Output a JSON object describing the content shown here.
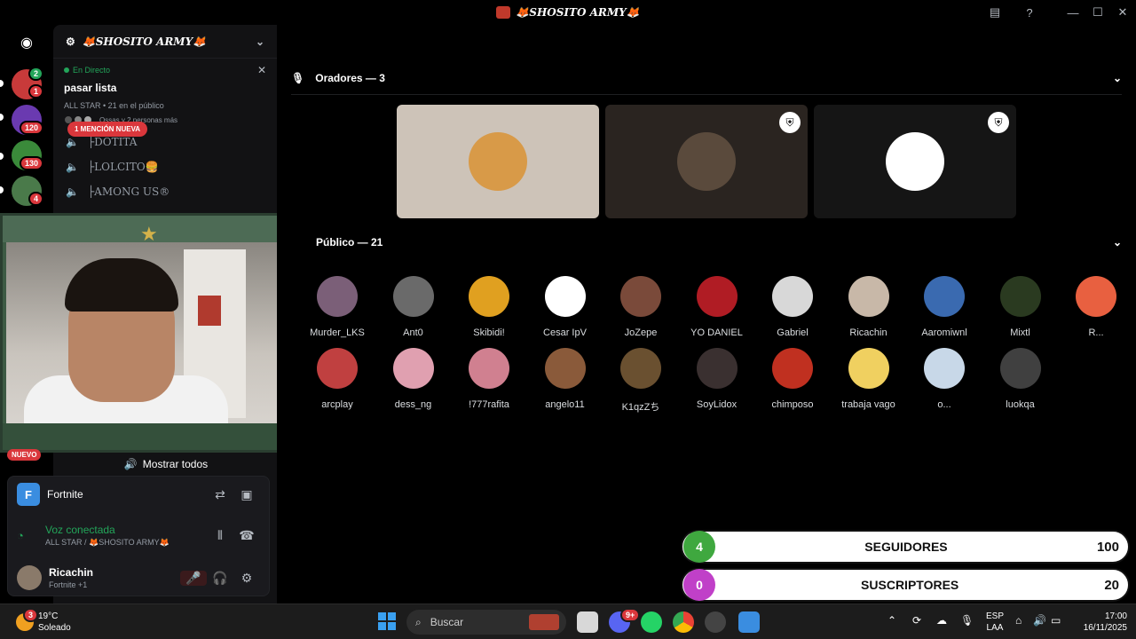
{
  "window": {
    "title": "🦊SHOSITO ARMY🦊",
    "controls": [
      "inbox-icon",
      "help-icon",
      "minimize",
      "maximize",
      "close"
    ]
  },
  "rail": {
    "badges": [
      "1",
      "120",
      "130",
      "4"
    ],
    "sub_badge": "2"
  },
  "server": {
    "name": "🦊SHOSITO ARMY🦊"
  },
  "live": {
    "tag": "En Directo",
    "title": "pasar lista",
    "meta": "ALL STAR • 21 en el público",
    "more": "Ossas y 2 personas más"
  },
  "voice_channels": [
    {
      "label": "├DOTITA"
    },
    {
      "label": "├LOLCITO🍔"
    },
    {
      "label": "├AMONG US®"
    }
  ],
  "mention_badge": "1 MENCIÓN NUEVA",
  "new_badge": "NUEVO",
  "show_all": "Mostrar todos",
  "game": {
    "icon_letter": "F",
    "name": "Fortnite"
  },
  "voice": {
    "status": "Voz conectada",
    "channel": "ALL STAR / 🦊SHOSITO ARMY🦊"
  },
  "user": {
    "name": "Ricachin",
    "activity": "Fortnite +1"
  },
  "stage": {
    "speakers_header": "Oradores — 3",
    "audience_header": "Público — 21",
    "speakers": [
      {
        "color": "#cdc3b8",
        "avatar": "#d89a48",
        "mod": false
      },
      {
        "color": "#2a2420",
        "avatar": "#5a4a3c",
        "mod": true
      },
      {
        "color": "#151515",
        "avatar": "#ffffff",
        "mod": true
      }
    ],
    "audience_row1": [
      {
        "name": "Murder_LKS",
        "color": "#7b5f78"
      },
      {
        "name": "Ant0",
        "color": "#6a6a6a"
      },
      {
        "name": "Skibidi!",
        "color": "#e0a020"
      },
      {
        "name": "Cesar IpV",
        "color": "#ffffff"
      },
      {
        "name": "JoZepe",
        "color": "#7a4a3a"
      },
      {
        "name": "YO DANIEL",
        "color": "#b01c24"
      },
      {
        "name": "Gabriel",
        "color": "#d8d8d8"
      },
      {
        "name": "Ricachin",
        "color": "#c8b8a8"
      },
      {
        "name": "Aaromiwnl",
        "color": "#3a6ab0"
      },
      {
        "name": "Mixtl",
        "color": "#2a3a20"
      },
      {
        "name": "R...",
        "color": "#e86040"
      }
    ],
    "audience_row2": [
      {
        "name": "arcplay",
        "color": "#c04040"
      },
      {
        "name": "dess_ng",
        "color": "#e0a0b0"
      },
      {
        "name": "!777rafita",
        "color": "#d08090"
      },
      {
        "name": "angelo11",
        "color": "#8a5a3a"
      },
      {
        "name": "K1qzZち",
        "color": "#6a5030"
      },
      {
        "name": "SoyLidox",
        "color": "#3a3030"
      },
      {
        "name": "chimposo",
        "color": "#c03020"
      },
      {
        "name": "trabaja vago",
        "color": "#f0d060"
      },
      {
        "name": "o...",
        "color": "#c8d8e8"
      },
      {
        "name": "luokqa",
        "color": "#404040"
      }
    ]
  },
  "counters": [
    {
      "label": "SEGUIDORES",
      "current": "4",
      "goal": "100",
      "color": "#3fa83f"
    },
    {
      "label": "SUSCRIPTORES",
      "current": "0",
      "goal": "20",
      "color": "#c040c8"
    }
  ],
  "taskbar": {
    "weather_temp": "19°C",
    "weather_desc": "Soleado",
    "weather_badge": "3",
    "search_placeholder": "Buscar",
    "discord_badge": "9+",
    "lang": "ESP",
    "lang_sub": "LAA",
    "time": "17:00",
    "date": "16/11/2025"
  }
}
